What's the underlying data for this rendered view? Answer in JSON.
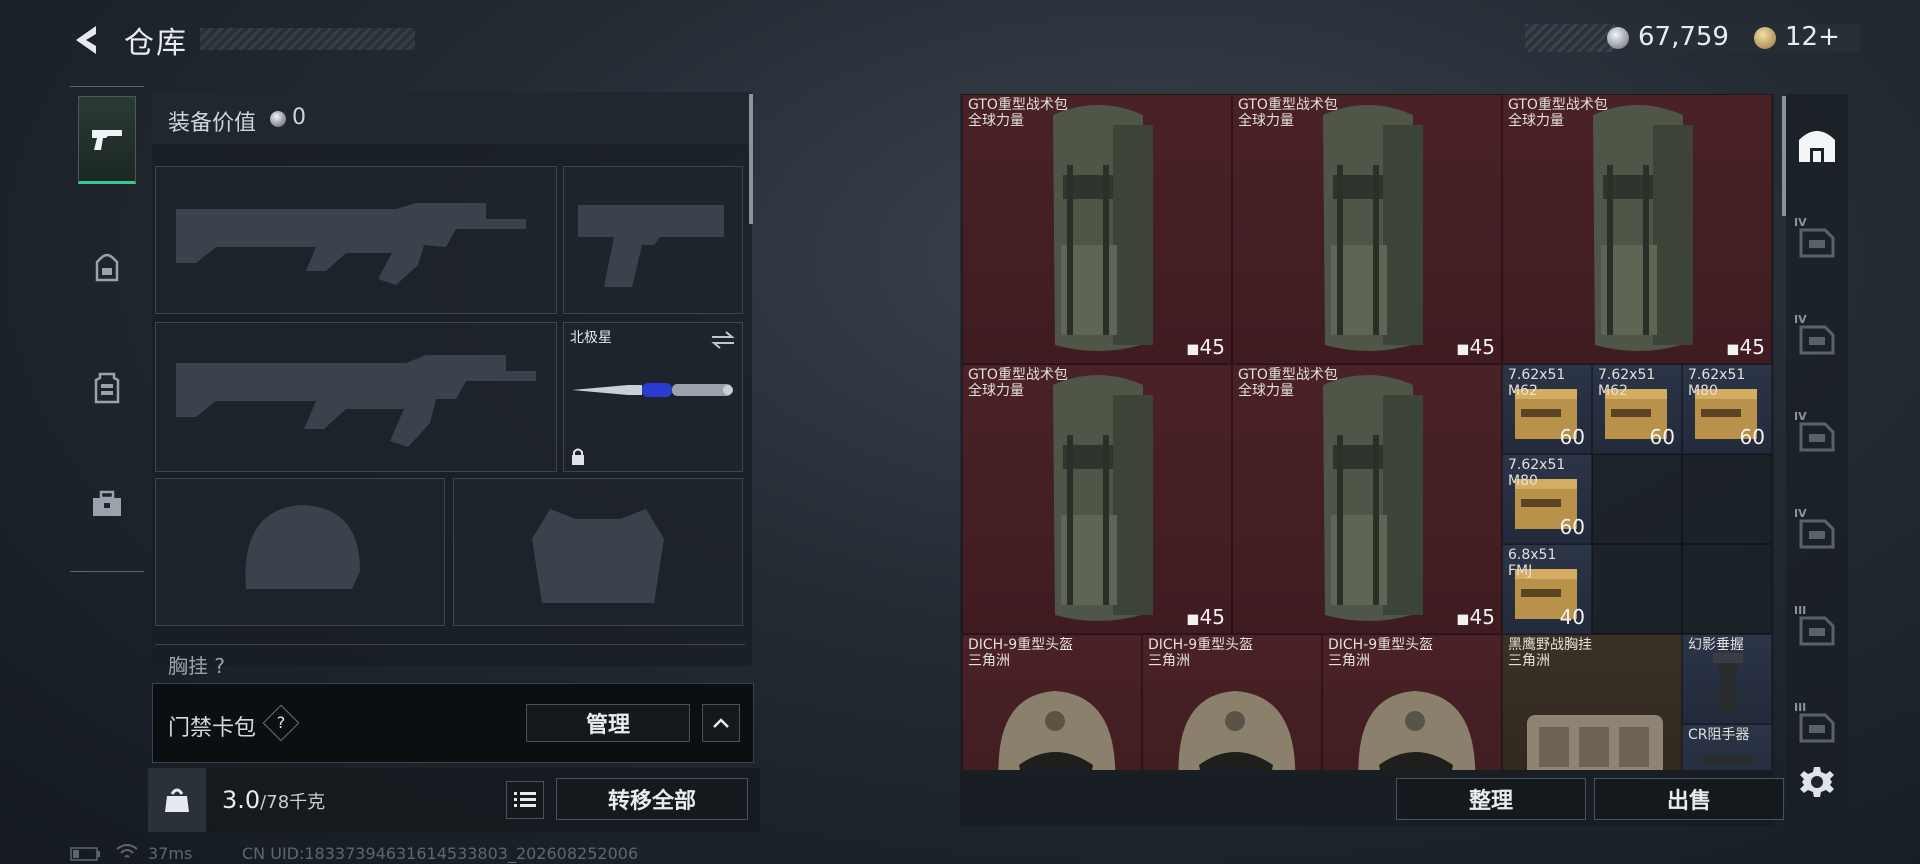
{
  "header": {
    "title": "仓库",
    "silver": "67,759",
    "gold": "12+"
  },
  "left_tabs": [
    {
      "icon": "pistol-icon",
      "active": true
    },
    {
      "icon": "backpack-icon",
      "active": false
    },
    {
      "icon": "vest-icon",
      "active": false
    },
    {
      "icon": "briefcase-icon",
      "active": false
    }
  ],
  "equipment": {
    "value_label": "装备价值",
    "value": "0",
    "knife_name": "北极星",
    "partial_label": "胸挂 ?"
  },
  "card_bag": {
    "label": "门禁卡包",
    "help": "?",
    "manage": "管理"
  },
  "bottom": {
    "weight": "3.0",
    "capacity": "/78千克",
    "transfer_all": "转移全部"
  },
  "status": {
    "ping": "37ms",
    "uid": "CN UID:18337394631614533803_202608252006"
  },
  "storage": {
    "items": [
      {
        "name": "GTO重型战术包",
        "sub": "全球力量",
        "count": "45",
        "kind": "bag"
      },
      {
        "name": "GTO重型战术包",
        "sub": "全球力量",
        "count": "45",
        "kind": "bag"
      },
      {
        "name": "GTO重型战术包",
        "sub": "全球力量",
        "count": "45",
        "kind": "bag"
      },
      {
        "name": "GTO重型战术包",
        "sub": "全球力量",
        "count": "45",
        "kind": "bag"
      },
      {
        "name": "GTO重型战术包",
        "sub": "全球力量",
        "count": "45",
        "kind": "bag"
      },
      {
        "name": "7.62x51",
        "sub": "M62",
        "count": "60",
        "kind": "ammo"
      },
      {
        "name": "7.62x51",
        "sub": "M62",
        "count": "60",
        "kind": "ammo"
      },
      {
        "name": "7.62x51",
        "sub": "M80",
        "count": "60",
        "kind": "ammo"
      },
      {
        "name": "7.62x51",
        "sub": "M80",
        "count": "60",
        "kind": "ammo"
      },
      {
        "name": "6.8x51",
        "sub": "FMJ",
        "count": "40",
        "kind": "ammo2"
      },
      {
        "name": "DICH-9重型头盔",
        "sub": "三角洲",
        "count": "",
        "kind": "helmet"
      },
      {
        "name": "DICH-9重型头盔",
        "sub": "三角洲",
        "count": "",
        "kind": "helmet"
      },
      {
        "name": "DICH-9重型头盔",
        "sub": "三角洲",
        "count": "",
        "kind": "helmet"
      },
      {
        "name": "黑鹰野战胸挂",
        "sub": "三角洲",
        "count": "",
        "kind": "rig"
      },
      {
        "name": "幻影垂握",
        "sub": "",
        "count": "",
        "kind": "grip"
      },
      {
        "name": "CR阻手器",
        "sub": "",
        "count": "",
        "kind": "stopper"
      }
    ],
    "sort": "整理",
    "sell": "出售"
  },
  "right_rail": {
    "tiers": [
      "IV",
      "IV",
      "IV",
      "IV",
      "III",
      "III"
    ]
  }
}
